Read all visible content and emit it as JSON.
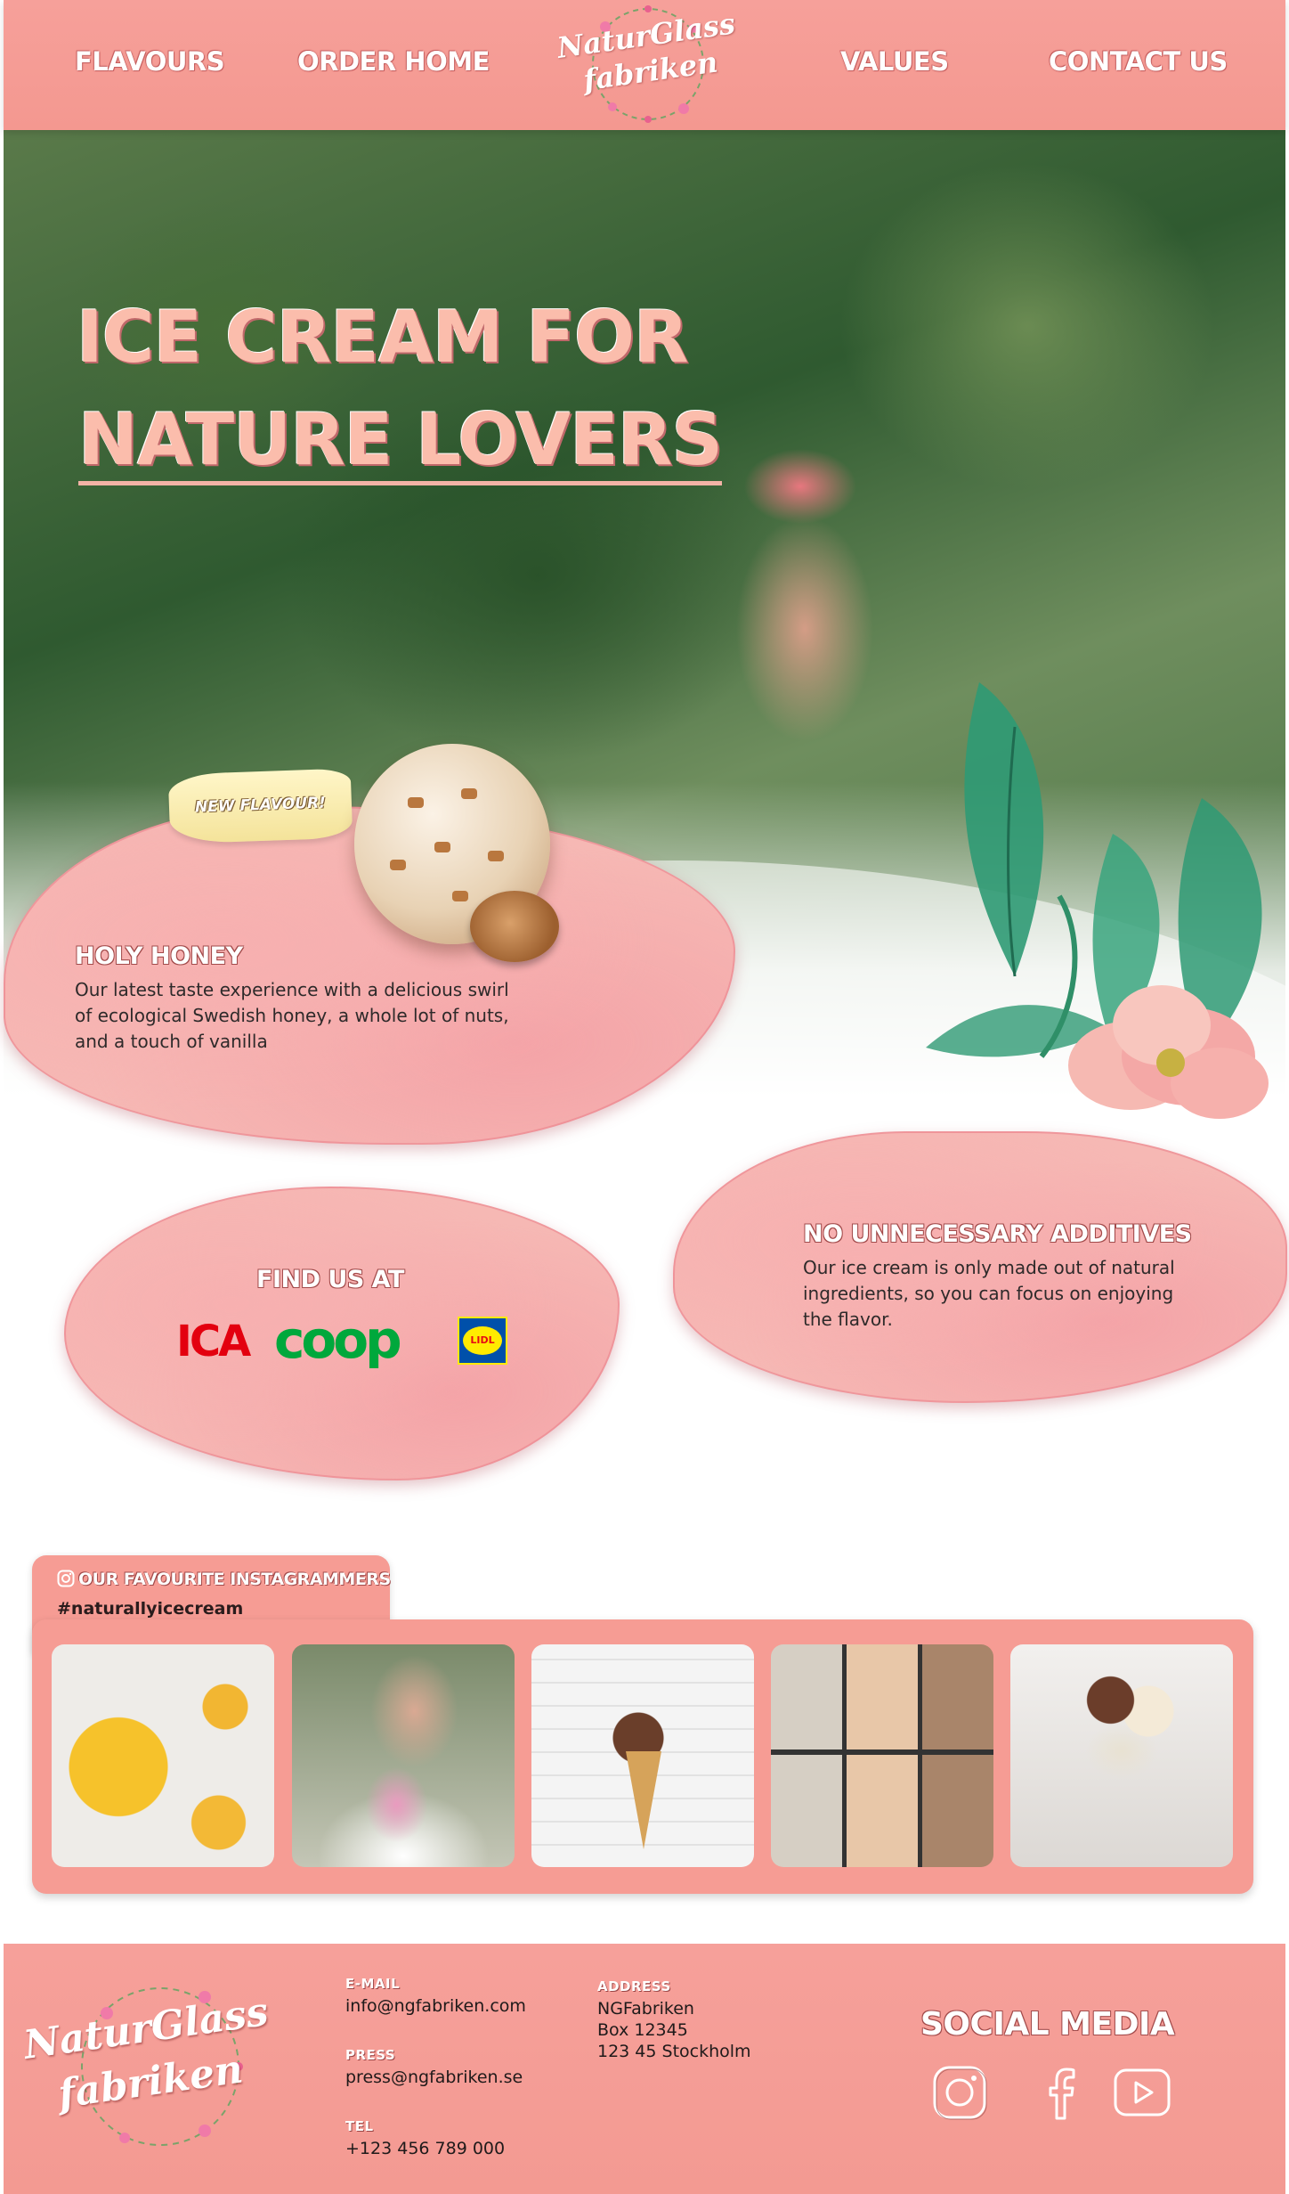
{
  "nav": {
    "items": [
      "FLAVOURS",
      "ORDER HOME",
      "VALUES",
      "CONTACT US"
    ]
  },
  "brand": {
    "line1": "NaturGlass",
    "line2": "fabriken"
  },
  "hero": {
    "title_line1": "ICE CREAM FOR",
    "title_line2": "NATURE LOVERS"
  },
  "feature": {
    "badge": "NEW FLAVOUR!",
    "title": "HOLY HONEY",
    "text_lines": [
      "Our latest taste experience with a delicious swirl",
      "of ecological Swedish honey, a whole lot of nuts,",
      "and a touch of vanilla"
    ]
  },
  "stores": {
    "title": "FIND US AT",
    "logos": [
      "ICA",
      "coop",
      "LIDL"
    ]
  },
  "additives": {
    "title": "NO UNNECESSARY ADDITIVES",
    "text_lines": [
      "Our ice cream is only made out of natural",
      "ingredients, so you can focus on enjoying",
      "the flavor."
    ]
  },
  "instagram": {
    "heading": "OUR FAVOURITE INSTAGRAMMERS",
    "hashtag": "#naturallyicecream"
  },
  "footer": {
    "email_label": "E-MAIL",
    "email": "info@ngfabriken.com",
    "press_label": "PRESS",
    "press": "press@ngfabriken.se",
    "tel_label": "TEL",
    "tel": "+123 456 789 000",
    "address_label": "ADDRESS",
    "address_lines": [
      "NGFabriken",
      "Box 12345",
      "123 45 Stockholm"
    ],
    "social_title": "SOCIAL MEDIA",
    "social_icons": [
      "instagram-icon",
      "facebook-icon",
      "youtube-icon"
    ]
  },
  "colors": {
    "header_pink": "#f6a09a",
    "title_pink": "#fbbdac",
    "ica_red": "#e3000f",
    "coop_green": "#00a83c",
    "lidl_blue": "#0050aa"
  }
}
